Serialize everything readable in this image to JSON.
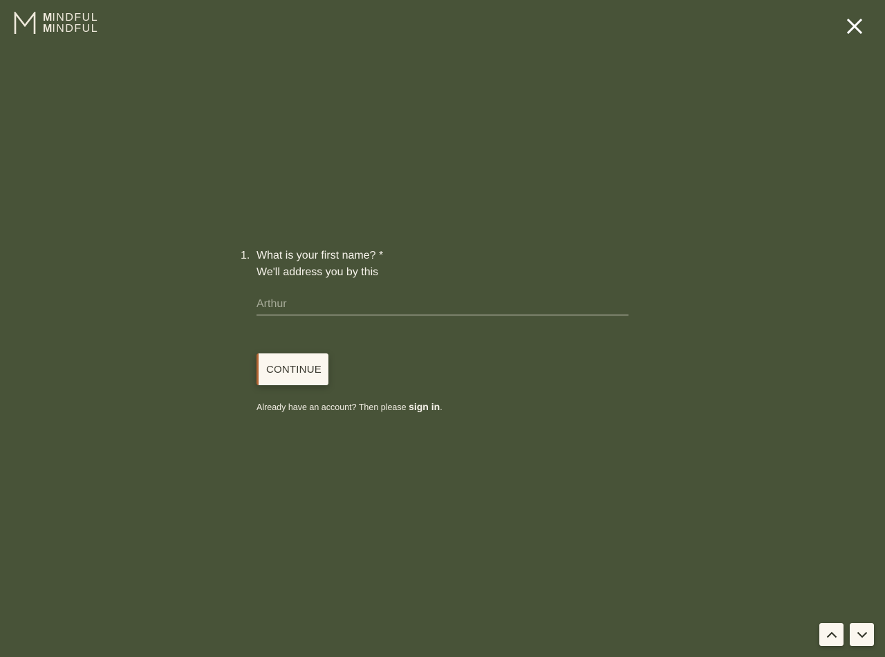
{
  "brand": {
    "logo_line1_initial": "M",
    "logo_line1_rest": "INDFUL",
    "logo_line2_initial": "M",
    "logo_line2_rest": "INDFUL"
  },
  "colors": {
    "background": "#485338",
    "button_background": "#fbf7ef",
    "button_accent": "#b36432",
    "text": "#f4f0e6"
  },
  "icons": {
    "logo": "monogram-m-icon",
    "close": "close-icon",
    "previous": "chevron-up-icon",
    "next": "chevron-down-icon"
  },
  "question": {
    "number": "1.",
    "title": "What is your first name? *",
    "subtitle": "We'll address you by this",
    "input_placeholder": "Arthur",
    "input_value": ""
  },
  "actions": {
    "continue_label": "CONTINUE"
  },
  "signin": {
    "prefix": "Already have an account? Then please ",
    "link_label": "sign in",
    "suffix": "."
  }
}
